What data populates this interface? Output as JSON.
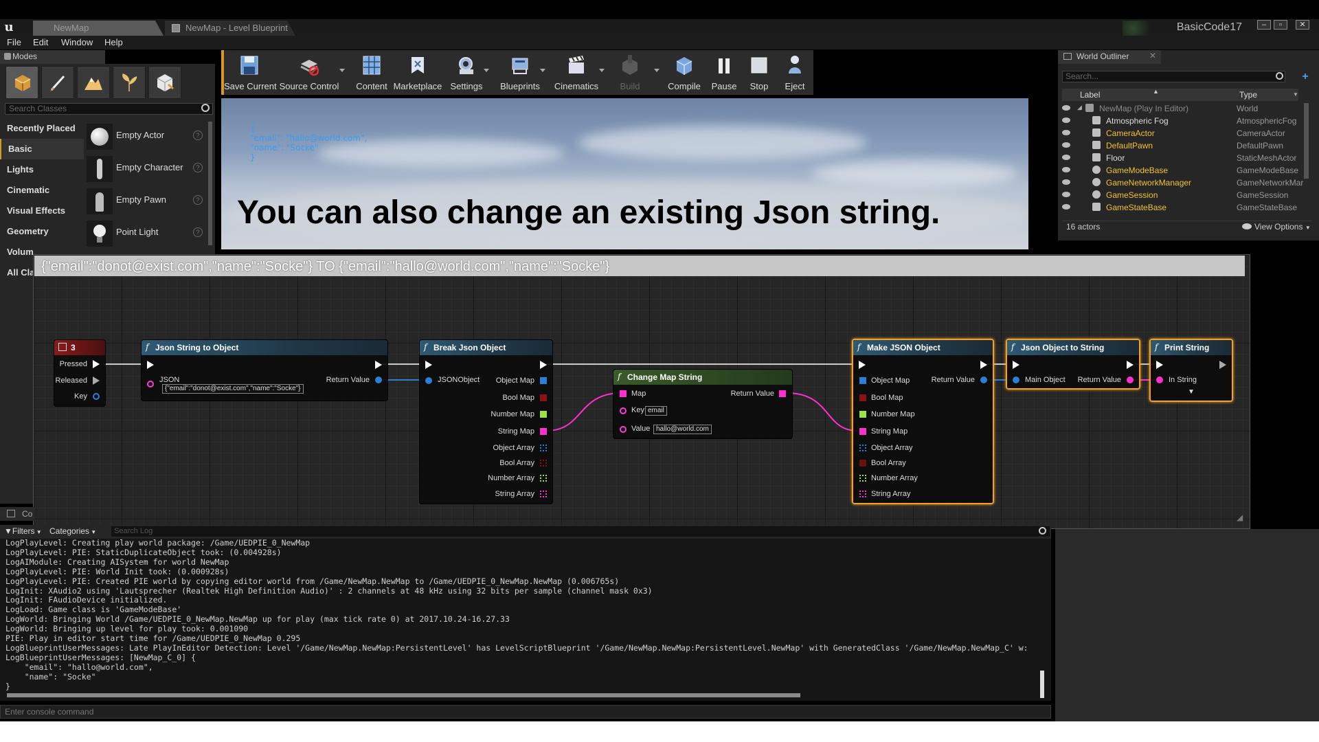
{
  "window": {
    "tabs": [
      {
        "label": "NewMap",
        "active": true
      },
      {
        "label": "NewMap - Level Blueprint",
        "active": false
      }
    ],
    "project_name": "BasicCode17",
    "controls": {
      "minimize": "–",
      "maximize": "▫",
      "close": "✕"
    }
  },
  "menu": [
    "File",
    "Edit",
    "Window",
    "Help"
  ],
  "modes": {
    "title": "Modes",
    "search_placeholder": "Search Classes",
    "categories": [
      "Recently Placed",
      "Basic",
      "Lights",
      "Cinematic",
      "Visual Effects",
      "Geometry",
      "Volum",
      "All Cla"
    ],
    "active_category": "Basic",
    "items": [
      {
        "label": "Empty Actor",
        "help": "?"
      },
      {
        "label": "Empty Character",
        "help": "?"
      },
      {
        "label": "Empty Pawn",
        "help": "?"
      },
      {
        "label": "Point Light",
        "help": "?"
      }
    ]
  },
  "toolbar": [
    {
      "label": "Save Current",
      "icon": "save-icon"
    },
    {
      "label": "Source Control",
      "icon": "source-control-icon"
    },
    {
      "label": "Content",
      "icon": "content-icon"
    },
    {
      "label": "Marketplace",
      "icon": "marketplace-icon"
    },
    {
      "label": "Settings",
      "icon": "settings-icon"
    },
    {
      "label": "Blueprints",
      "icon": "blueprints-icon"
    },
    {
      "label": "Cinematics",
      "icon": "cinematics-icon"
    },
    {
      "label": "Build",
      "icon": "build-icon",
      "disabled": true
    },
    {
      "label": "Compile",
      "icon": "compile-icon"
    },
    {
      "label": "Pause",
      "icon": "pause-icon"
    },
    {
      "label": "Stop",
      "icon": "stop-icon"
    },
    {
      "label": "Eject",
      "icon": "eject-icon"
    }
  ],
  "viewport": {
    "printed_json": "{\n\"email\": \"hallo@world.com\",\n\"name\": \"Socke\"\n}",
    "caption": "You can also change an existing Json string."
  },
  "outliner": {
    "title": "World Outliner",
    "close": "✕",
    "search_placeholder": "Search...",
    "columns": {
      "label": "Label",
      "type": "Type"
    },
    "rows": [
      {
        "label": "NewMap (Play In Editor)",
        "type": "World",
        "color": "#8a8a8a"
      },
      {
        "label": "Atmospheric Fog",
        "type": "AtmosphericFog",
        "color": "#dddddd"
      },
      {
        "label": "CameraActor",
        "type": "CameraActor",
        "color": "#f2c230"
      },
      {
        "label": "DefaultPawn",
        "type": "DefaultPawn",
        "color": "#f2c230"
      },
      {
        "label": "Floor",
        "type": "StaticMeshActor",
        "color": "#dddddd"
      },
      {
        "label": "GameModeBase",
        "type": "GameModeBase",
        "color": "#f2c230"
      },
      {
        "label": "GameNetworkManager",
        "type": "GameNetworkMar",
        "color": "#f2c230"
      },
      {
        "label": "GameSession",
        "type": "GameSession",
        "color": "#f2c230"
      },
      {
        "label": "GameStateBase",
        "type": "GameStateBase",
        "color": "#f2c230"
      }
    ],
    "actor_count": "16 actors",
    "view_options": "View Options"
  },
  "graph": {
    "comment": "{\"email\":\"donot@exist.com\",\"name\":\"Socke\"} TO {\"email\":\"hallo@world.com\",\"name\":\"Socke\"}",
    "key_node": {
      "title": "3",
      "pins": [
        "Pressed",
        "Released",
        "Key"
      ]
    },
    "json_string_to_object": {
      "title": "Json String to Object",
      "input_label": "JSON",
      "input_value": "{\"email\":\"donot@exist.com\",\"name\":\"Socke\"}",
      "output_label": "Return Value"
    },
    "break_json": {
      "title": "Break Json Object",
      "input_label": "JSONObject",
      "outputs": [
        "Object Map",
        "Bool Map",
        "Number Map",
        "String Map",
        "Object Array",
        "Bool Array",
        "Number Array",
        "String Array"
      ]
    },
    "change_map": {
      "title": "Change Map String",
      "map_label": "Map",
      "key_label": "Key",
      "key_value": "email",
      "value_label": "Value",
      "value_value": "hallo@world.com",
      "output_label": "Return Value"
    },
    "make_json": {
      "title": "Make JSON Object",
      "inputs": [
        "Object Map",
        "Bool Map",
        "Number Map",
        "String Map",
        "Object Array",
        "Bool Array",
        "Number Array",
        "String Array"
      ],
      "output_label": "Return Value"
    },
    "json_to_string": {
      "title": "Json Object to String",
      "input_label": "Main Object",
      "output_label": "Return Value"
    },
    "print_string": {
      "title": "Print String",
      "input_label": "In String"
    }
  },
  "log": {
    "tab_label": "Co",
    "filters": "Filters",
    "categories": "Categories",
    "search_placeholder": "Search Log",
    "lines": "LogPlayLevel: Creating play world package: /Game/UEDPIE_0_NewMap\nLogPlayLevel: PIE: StaticDuplicateObject took: (0.004928s)\nLogAIModule: Creating AISystem for world NewMap\nLogPlayLevel: PIE: World Init took: (0.000928s)\nLogPlayLevel: PIE: Created PIE world by copying editor world from /Game/NewMap.NewMap to /Game/UEDPIE_0_NewMap.NewMap (0.006765s)\nLogInit: XAudio2 using 'Lautsprecher (Realtek High Definition Audio)' : 2 channels at 48 kHz using 32 bits per sample (channel mask 0x3)\nLogInit: FAudioDevice initialized.\nLogLoad: Game class is 'GameModeBase'\nLogWorld: Bringing World /Game/UEDPIE_0_NewMap.NewMap up for play (max tick rate 0) at 2017.10.24-16.27.33\nLogWorld: Bringing up level for play took: 0.001090\nPIE: Play in editor start time for /Game/UEDPIE_0_NewMap 0.295\nLogBlueprintUserMessages: Late PlayInEditor Detection: Level '/Game/NewMap.NewMap:PersistentLevel' has LevelScriptBlueprint '/Game/NewMap.NewMap:PersistentLevel.NewMap' with GeneratedClass '/Game/NewMap.NewMap_C' w:\nLogBlueprintUserMessages: [NewMap_C_0] {\n    \"email\": \"hallo@world.com\",\n    \"name\": \"Socke\"\n}",
    "console_placeholder": "Enter console command"
  },
  "colors": {
    "accent": "#d79a27",
    "exec": "#ffffff",
    "object_pin": "#2a7fd6",
    "map_pin": "#ff2fd0",
    "bool_pin": "#8c1111",
    "number_pin": "#9be34a",
    "string_pin": "#ff3bd8",
    "selection": "#f3a024"
  }
}
